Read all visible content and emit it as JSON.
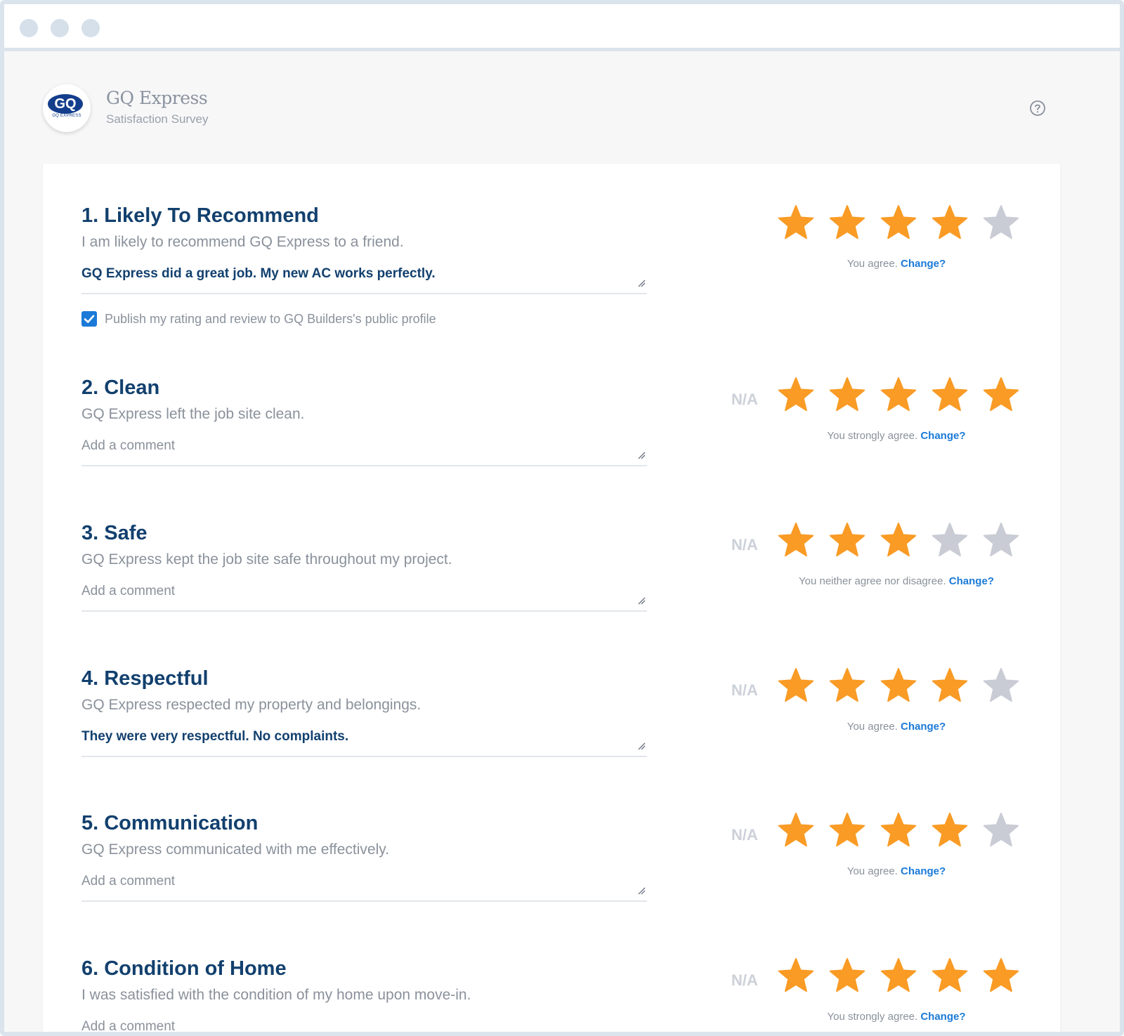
{
  "header": {
    "company_name": "GQ Express",
    "survey_title": "Satisfaction Survey",
    "logo_text": "GQ",
    "logo_subtext": "GQ EXPRESS",
    "help_icon": "question-circle-icon"
  },
  "colors": {
    "title": "#12406e",
    "star_on": "#f99b25",
    "star_off": "#c9ccd5",
    "link": "#1a7ad8",
    "checkbox": "#1a7ad8"
  },
  "questions": [
    {
      "title": "1. Likely To Recommend",
      "description": "I am likely to recommend  GQ Express  to a friend.",
      "comment": "GQ Express did a great job. My new AC works perfectly.",
      "comment_placeholder": "Add a comment",
      "rating": 4,
      "max_rating": 5,
      "rating_text": "You agree.",
      "change_label": "Change?",
      "show_na": false,
      "publish": {
        "checked": true,
        "label": "Publish my rating and review to GQ Builders's public profile"
      }
    },
    {
      "title": "2. Clean",
      "description": "GQ Express left the job site clean.",
      "comment": "",
      "comment_placeholder": "Add a comment",
      "rating": 5,
      "max_rating": 5,
      "rating_text": "You strongly agree.",
      "change_label": "Change?",
      "show_na": true,
      "na_label": "N/A"
    },
    {
      "title": "3. Safe",
      "description": "GQ Express kept the job site safe throughout my project.",
      "comment": "",
      "comment_placeholder": "Add a comment",
      "rating": 3,
      "max_rating": 5,
      "rating_text": "You neither agree nor disagree.",
      "change_label": "Change?",
      "show_na": true,
      "na_label": "N/A"
    },
    {
      "title": "4. Respectful",
      "description": "GQ Express respected my property and belongings.",
      "comment": "They were very respectful. No complaints.",
      "comment_placeholder": "Add a comment",
      "rating": 4,
      "max_rating": 5,
      "rating_text": "You agree.",
      "change_label": "Change?",
      "show_na": true,
      "na_label": "N/A"
    },
    {
      "title": "5. Communication",
      "description": "GQ Express communicated with me effectively.",
      "comment": "",
      "comment_placeholder": "Add a comment",
      "rating": 4,
      "max_rating": 5,
      "rating_text": "You agree.",
      "change_label": "Change?",
      "show_na": true,
      "na_label": "N/A"
    },
    {
      "title": "6. Condition of Home",
      "description": "I was satisfied with the condition of my home upon move-in.",
      "comment": "",
      "comment_placeholder": "Add a comment",
      "rating": 5,
      "max_rating": 5,
      "rating_text": "You strongly agree.",
      "change_label": "Change?",
      "show_na": true,
      "na_label": "N/A"
    }
  ]
}
